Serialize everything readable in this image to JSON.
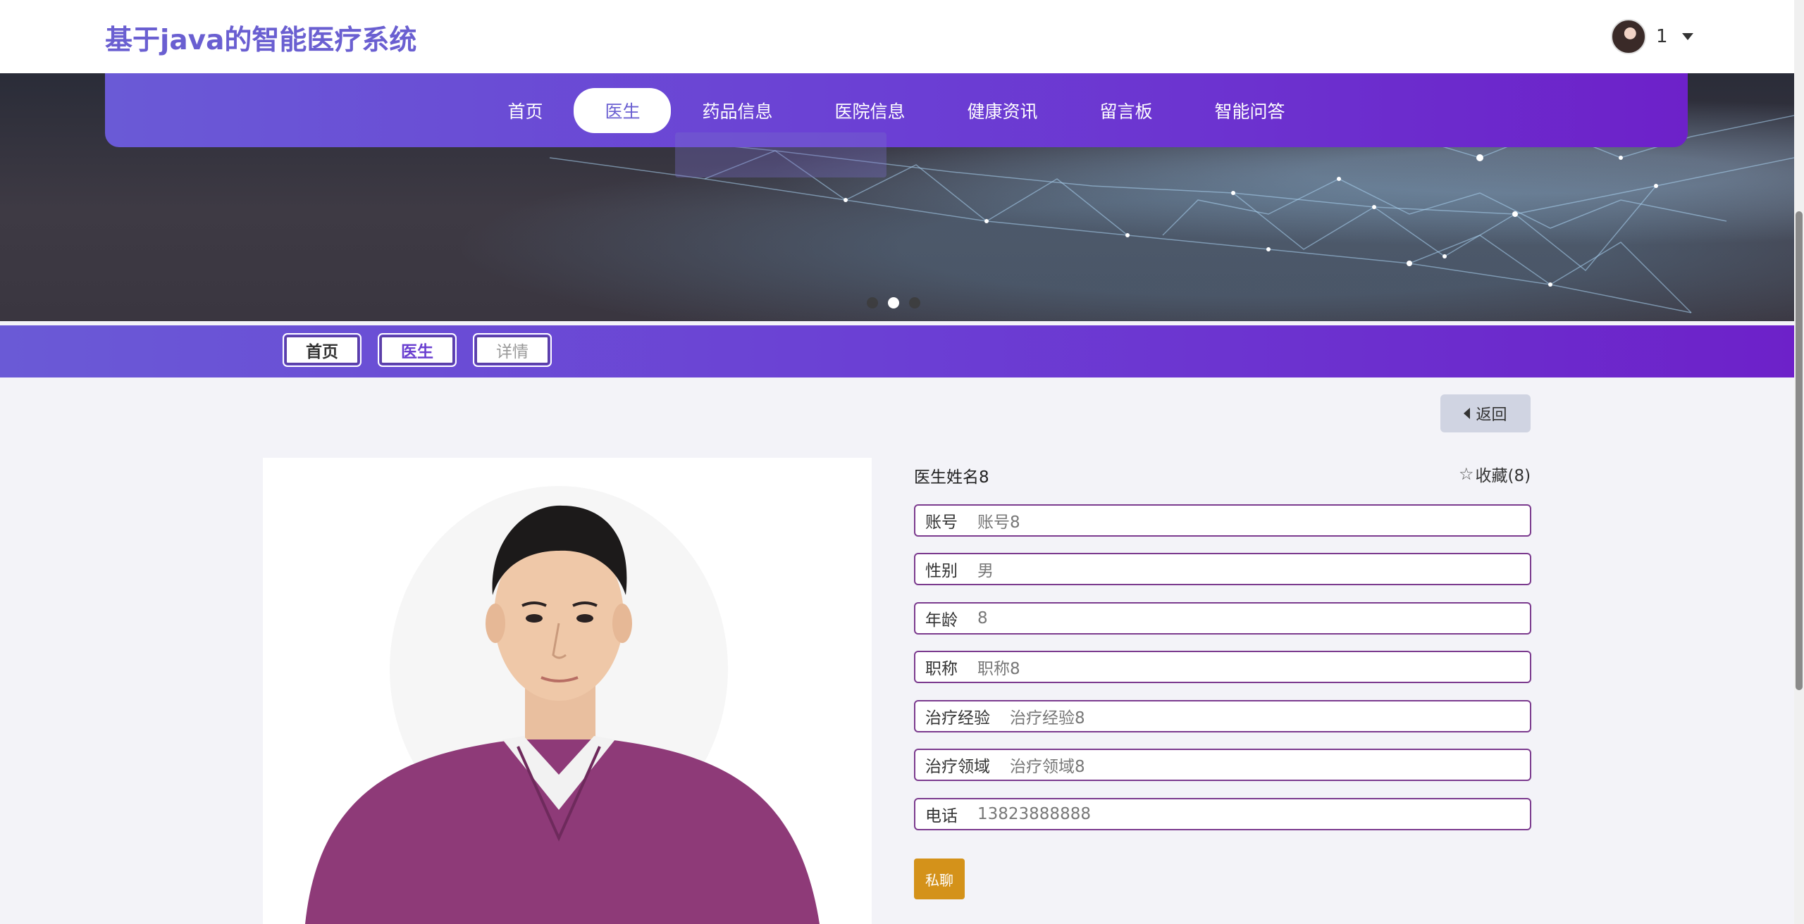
{
  "header": {
    "site_title": "基于java的智能医疗系统",
    "user_name": "1"
  },
  "nav": {
    "items": [
      "首页",
      "医生",
      "药品信息",
      "医院信息",
      "健康资讯",
      "留言板",
      "智能问答"
    ],
    "active_index": 1
  },
  "carousel": {
    "slide_count": 3,
    "active_index": 1
  },
  "breadcrumb": [
    "首页",
    "医生",
    "详情"
  ],
  "detail": {
    "back_label": "返回",
    "doctor_name": "医生姓名8",
    "favorite_label": "收藏(8)",
    "fields": [
      {
        "label": "账号",
        "value": "账号8"
      },
      {
        "label": "性别",
        "value": "男"
      },
      {
        "label": "年龄",
        "value": "8"
      },
      {
        "label": "职称",
        "value": "职称8"
      },
      {
        "label": "治疗经验",
        "value": "治疗经验8"
      },
      {
        "label": "治疗领域",
        "value": "治疗领域8"
      },
      {
        "label": "电话",
        "value": "13823888888"
      }
    ],
    "chat_label": "私聊"
  },
  "colors": {
    "brand": "#6a5fd1",
    "nav_gradient_start": "#6a5ad6",
    "nav_gradient_end": "#6d21c9",
    "chat_button": "#d4921a",
    "field_border": "#7b3a8e"
  }
}
